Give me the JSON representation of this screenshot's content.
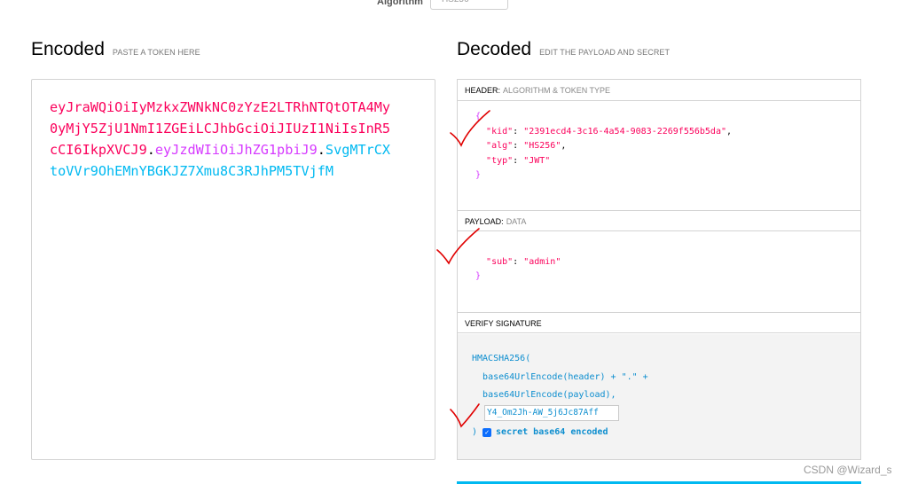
{
  "algorithm": {
    "label": "Algorithm",
    "value": "HS256"
  },
  "encoded": {
    "title": "Encoded",
    "hint": "PASTE A TOKEN HERE",
    "token_header": "eyJraWQiOiIyMzkxZWNkNC0zYzE2LTRhNTQtOTA4My0yMjY5ZjU1NmI1ZGEiLCJhbGciOiJIUzI1NiIsInR5cCI6IkpXVCJ9",
    "dot": ".",
    "token_payload": "eyJzdWIiOiJhZG1pbiJ9",
    "token_signature": "SvgMTrCXtoVVr9OhEMnYBGKJZ7Xmu8C3RJhPM5TVjfM"
  },
  "decoded": {
    "title": "Decoded",
    "hint": "EDIT THE PAYLOAD AND SECRET",
    "header_label": "HEADER:",
    "header_sub": "ALGORITHM & TOKEN TYPE",
    "header_json": {
      "kid_key": "\"kid\"",
      "kid_val": "\"2391ecd4-3c16-4a54-9083-2269f556b5da\"",
      "alg_key": "\"alg\"",
      "alg_val": "\"HS256\"",
      "typ_key": "\"typ\"",
      "typ_val": "\"JWT\""
    },
    "payload_label": "PAYLOAD:",
    "payload_sub": "DATA",
    "payload_json": {
      "sub_key": "\"sub\"",
      "sub_val": "\"admin\""
    },
    "verify_label": "VERIFY SIGNATURE",
    "verify": {
      "fn": "HMACSHA256(",
      "line1": "base64UrlEncode(header) + \".\" +",
      "line2": "base64UrlEncode(payload),",
      "secret": "Y4_Om2Jh-AW_5j6Jc87Aff",
      "close": ")",
      "checkbox_label": "secret base64 encoded",
      "checked": true
    }
  },
  "watermark": "CSDN @Wizard_s",
  "colors": {
    "header": "#fb015b",
    "payload": "#d63aff",
    "signature": "#00b9f1",
    "annotation": "#e00000"
  }
}
